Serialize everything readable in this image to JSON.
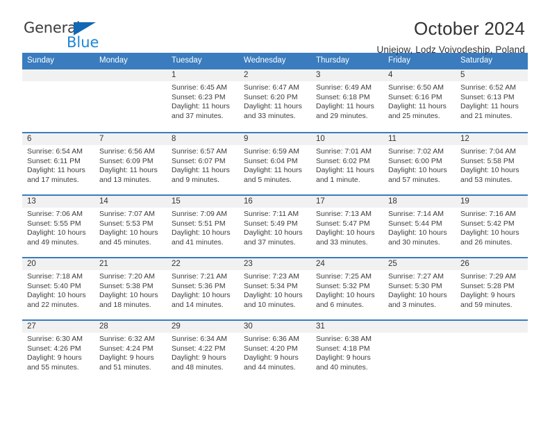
{
  "branding": {
    "name_part1": "General",
    "name_part2": "Blue",
    "accent_color": "#1d86d4",
    "triangle_color": "#1268b3"
  },
  "header": {
    "title": "October 2024",
    "subtitle": "Uniejow, Lodz Voivodeship, Poland"
  },
  "calendar": {
    "header_bg": "#3a7cbe",
    "day_band_bg": "#f1f1f1",
    "weekday_headers": [
      "Sunday",
      "Monday",
      "Tuesday",
      "Wednesday",
      "Thursday",
      "Friday",
      "Saturday"
    ],
    "weeks": [
      [
        {
          "day": "",
          "sunrise": "",
          "sunset": "",
          "daylight_line1": "",
          "daylight_line2": ""
        },
        {
          "day": "",
          "sunrise": "",
          "sunset": "",
          "daylight_line1": "",
          "daylight_line2": ""
        },
        {
          "day": "1",
          "sunrise": "Sunrise: 6:45 AM",
          "sunset": "Sunset: 6:23 PM",
          "daylight_line1": "Daylight: 11 hours",
          "daylight_line2": "and 37 minutes."
        },
        {
          "day": "2",
          "sunrise": "Sunrise: 6:47 AM",
          "sunset": "Sunset: 6:20 PM",
          "daylight_line1": "Daylight: 11 hours",
          "daylight_line2": "and 33 minutes."
        },
        {
          "day": "3",
          "sunrise": "Sunrise: 6:49 AM",
          "sunset": "Sunset: 6:18 PM",
          "daylight_line1": "Daylight: 11 hours",
          "daylight_line2": "and 29 minutes."
        },
        {
          "day": "4",
          "sunrise": "Sunrise: 6:50 AM",
          "sunset": "Sunset: 6:16 PM",
          "daylight_line1": "Daylight: 11 hours",
          "daylight_line2": "and 25 minutes."
        },
        {
          "day": "5",
          "sunrise": "Sunrise: 6:52 AM",
          "sunset": "Sunset: 6:13 PM",
          "daylight_line1": "Daylight: 11 hours",
          "daylight_line2": "and 21 minutes."
        }
      ],
      [
        {
          "day": "6",
          "sunrise": "Sunrise: 6:54 AM",
          "sunset": "Sunset: 6:11 PM",
          "daylight_line1": "Daylight: 11 hours",
          "daylight_line2": "and 17 minutes."
        },
        {
          "day": "7",
          "sunrise": "Sunrise: 6:56 AM",
          "sunset": "Sunset: 6:09 PM",
          "daylight_line1": "Daylight: 11 hours",
          "daylight_line2": "and 13 minutes."
        },
        {
          "day": "8",
          "sunrise": "Sunrise: 6:57 AM",
          "sunset": "Sunset: 6:07 PM",
          "daylight_line1": "Daylight: 11 hours",
          "daylight_line2": "and 9 minutes."
        },
        {
          "day": "9",
          "sunrise": "Sunrise: 6:59 AM",
          "sunset": "Sunset: 6:04 PM",
          "daylight_line1": "Daylight: 11 hours",
          "daylight_line2": "and 5 minutes."
        },
        {
          "day": "10",
          "sunrise": "Sunrise: 7:01 AM",
          "sunset": "Sunset: 6:02 PM",
          "daylight_line1": "Daylight: 11 hours",
          "daylight_line2": "and 1 minute."
        },
        {
          "day": "11",
          "sunrise": "Sunrise: 7:02 AM",
          "sunset": "Sunset: 6:00 PM",
          "daylight_line1": "Daylight: 10 hours",
          "daylight_line2": "and 57 minutes."
        },
        {
          "day": "12",
          "sunrise": "Sunrise: 7:04 AM",
          "sunset": "Sunset: 5:58 PM",
          "daylight_line1": "Daylight: 10 hours",
          "daylight_line2": "and 53 minutes."
        }
      ],
      [
        {
          "day": "13",
          "sunrise": "Sunrise: 7:06 AM",
          "sunset": "Sunset: 5:55 PM",
          "daylight_line1": "Daylight: 10 hours",
          "daylight_line2": "and 49 minutes."
        },
        {
          "day": "14",
          "sunrise": "Sunrise: 7:07 AM",
          "sunset": "Sunset: 5:53 PM",
          "daylight_line1": "Daylight: 10 hours",
          "daylight_line2": "and 45 minutes."
        },
        {
          "day": "15",
          "sunrise": "Sunrise: 7:09 AM",
          "sunset": "Sunset: 5:51 PM",
          "daylight_line1": "Daylight: 10 hours",
          "daylight_line2": "and 41 minutes."
        },
        {
          "day": "16",
          "sunrise": "Sunrise: 7:11 AM",
          "sunset": "Sunset: 5:49 PM",
          "daylight_line1": "Daylight: 10 hours",
          "daylight_line2": "and 37 minutes."
        },
        {
          "day": "17",
          "sunrise": "Sunrise: 7:13 AM",
          "sunset": "Sunset: 5:47 PM",
          "daylight_line1": "Daylight: 10 hours",
          "daylight_line2": "and 33 minutes."
        },
        {
          "day": "18",
          "sunrise": "Sunrise: 7:14 AM",
          "sunset": "Sunset: 5:44 PM",
          "daylight_line1": "Daylight: 10 hours",
          "daylight_line2": "and 30 minutes."
        },
        {
          "day": "19",
          "sunrise": "Sunrise: 7:16 AM",
          "sunset": "Sunset: 5:42 PM",
          "daylight_line1": "Daylight: 10 hours",
          "daylight_line2": "and 26 minutes."
        }
      ],
      [
        {
          "day": "20",
          "sunrise": "Sunrise: 7:18 AM",
          "sunset": "Sunset: 5:40 PM",
          "daylight_line1": "Daylight: 10 hours",
          "daylight_line2": "and 22 minutes."
        },
        {
          "day": "21",
          "sunrise": "Sunrise: 7:20 AM",
          "sunset": "Sunset: 5:38 PM",
          "daylight_line1": "Daylight: 10 hours",
          "daylight_line2": "and 18 minutes."
        },
        {
          "day": "22",
          "sunrise": "Sunrise: 7:21 AM",
          "sunset": "Sunset: 5:36 PM",
          "daylight_line1": "Daylight: 10 hours",
          "daylight_line2": "and 14 minutes."
        },
        {
          "day": "23",
          "sunrise": "Sunrise: 7:23 AM",
          "sunset": "Sunset: 5:34 PM",
          "daylight_line1": "Daylight: 10 hours",
          "daylight_line2": "and 10 minutes."
        },
        {
          "day": "24",
          "sunrise": "Sunrise: 7:25 AM",
          "sunset": "Sunset: 5:32 PM",
          "daylight_line1": "Daylight: 10 hours",
          "daylight_line2": "and 6 minutes."
        },
        {
          "day": "25",
          "sunrise": "Sunrise: 7:27 AM",
          "sunset": "Sunset: 5:30 PM",
          "daylight_line1": "Daylight: 10 hours",
          "daylight_line2": "and 3 minutes."
        },
        {
          "day": "26",
          "sunrise": "Sunrise: 7:29 AM",
          "sunset": "Sunset: 5:28 PM",
          "daylight_line1": "Daylight: 9 hours",
          "daylight_line2": "and 59 minutes."
        }
      ],
      [
        {
          "day": "27",
          "sunrise": "Sunrise: 6:30 AM",
          "sunset": "Sunset: 4:26 PM",
          "daylight_line1": "Daylight: 9 hours",
          "daylight_line2": "and 55 minutes."
        },
        {
          "day": "28",
          "sunrise": "Sunrise: 6:32 AM",
          "sunset": "Sunset: 4:24 PM",
          "daylight_line1": "Daylight: 9 hours",
          "daylight_line2": "and 51 minutes."
        },
        {
          "day": "29",
          "sunrise": "Sunrise: 6:34 AM",
          "sunset": "Sunset: 4:22 PM",
          "daylight_line1": "Daylight: 9 hours",
          "daylight_line2": "and 48 minutes."
        },
        {
          "day": "30",
          "sunrise": "Sunrise: 6:36 AM",
          "sunset": "Sunset: 4:20 PM",
          "daylight_line1": "Daylight: 9 hours",
          "daylight_line2": "and 44 minutes."
        },
        {
          "day": "31",
          "sunrise": "Sunrise: 6:38 AM",
          "sunset": "Sunset: 4:18 PM",
          "daylight_line1": "Daylight: 9 hours",
          "daylight_line2": "and 40 minutes."
        },
        {
          "day": "",
          "sunrise": "",
          "sunset": "",
          "daylight_line1": "",
          "daylight_line2": ""
        },
        {
          "day": "",
          "sunrise": "",
          "sunset": "",
          "daylight_line1": "",
          "daylight_line2": ""
        }
      ]
    ]
  }
}
